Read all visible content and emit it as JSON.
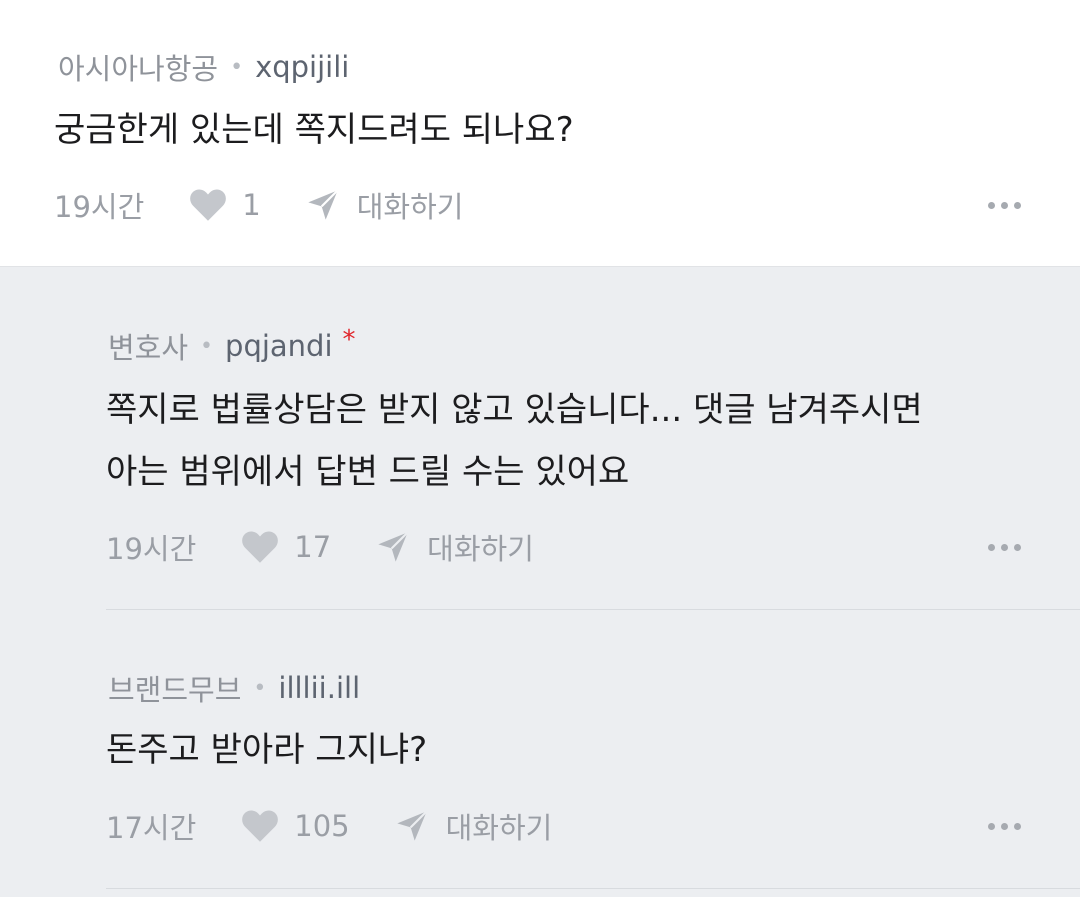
{
  "comment": {
    "author_title": "아시아나항공",
    "author_nick": "xqpijili",
    "text": "궁금한게 있는데 쪽지드려도 되나요?",
    "time": "19시간",
    "likes": "1",
    "reply_label": "대화하기"
  },
  "replies": [
    {
      "author_title": "변호사",
      "author_nick": "pqjandi",
      "author_badge": "*",
      "text_line1": "쪽지로 법률상담은 받지 않고 있습니다... 댓글 남겨주시면",
      "text_line2": "아는 범위에서 답변 드릴 수는 있어요",
      "time": "19시간",
      "likes": "17",
      "reply_label": "대화하기"
    },
    {
      "author_title": "브랜드무브",
      "author_nick": "illlii.ill",
      "text_line1": "돈주고 받아라 그지냐?",
      "time": "17시간",
      "likes": "105",
      "reply_label": "대화하기"
    }
  ],
  "colors": {
    "heart": "#c4c7cc",
    "badge": "#e0252b",
    "reply_bg": "#eceef1"
  },
  "icons": [
    "heart-icon",
    "send-icon",
    "more-dots-icon"
  ]
}
